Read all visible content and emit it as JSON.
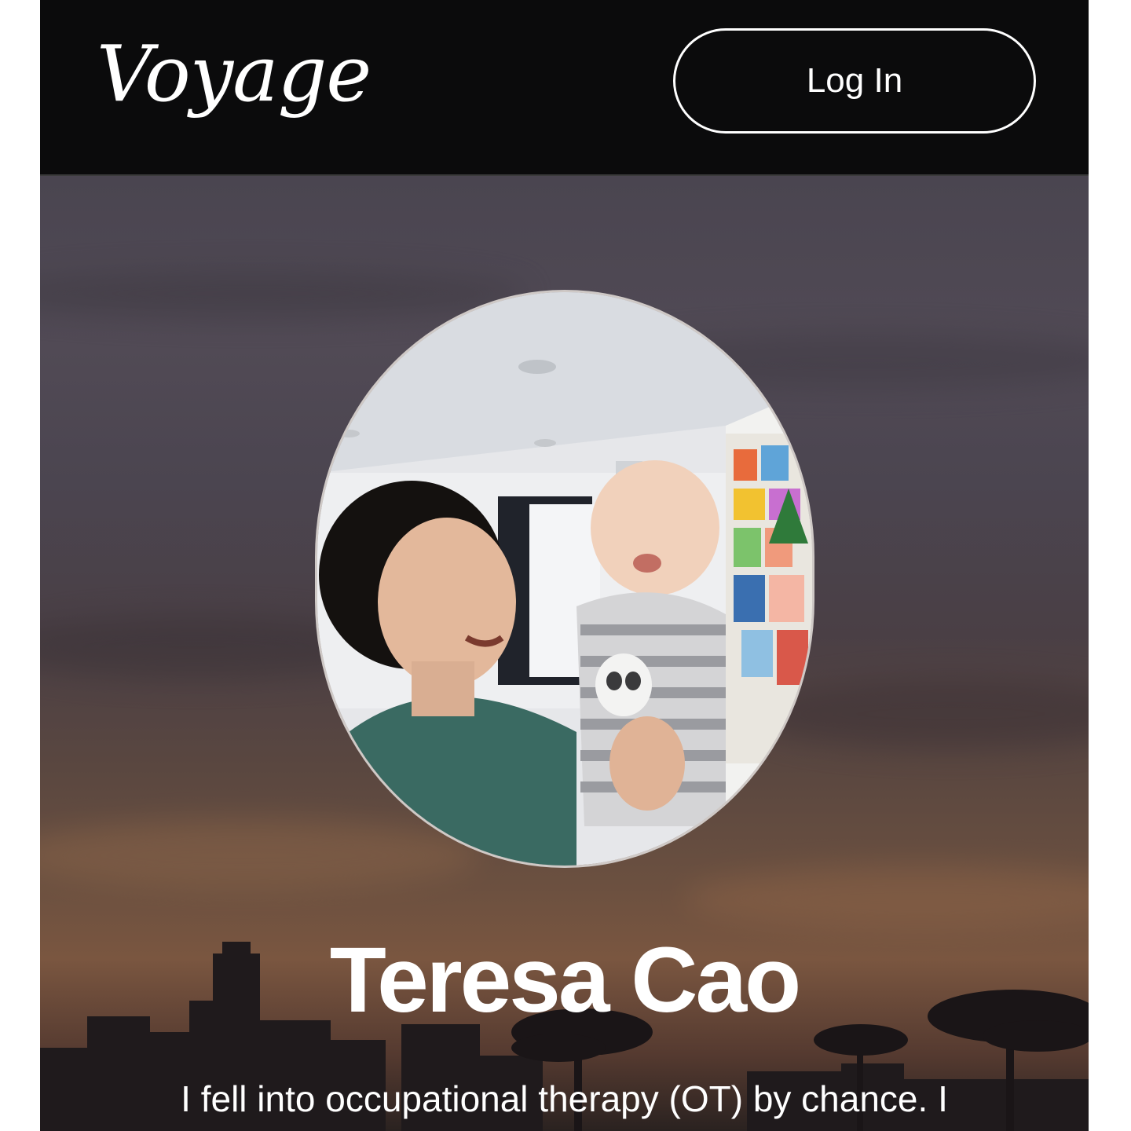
{
  "header": {
    "logo_text": "Voyage",
    "login_label": "Log In"
  },
  "profile": {
    "photo_icon": "profile-photo-image",
    "name": "Teresa Cao",
    "intro_text": "I fell into occupational therapy (OT) by chance. I"
  },
  "colors": {
    "header_bg": "#0b0b0c",
    "text": "#ffffff"
  }
}
